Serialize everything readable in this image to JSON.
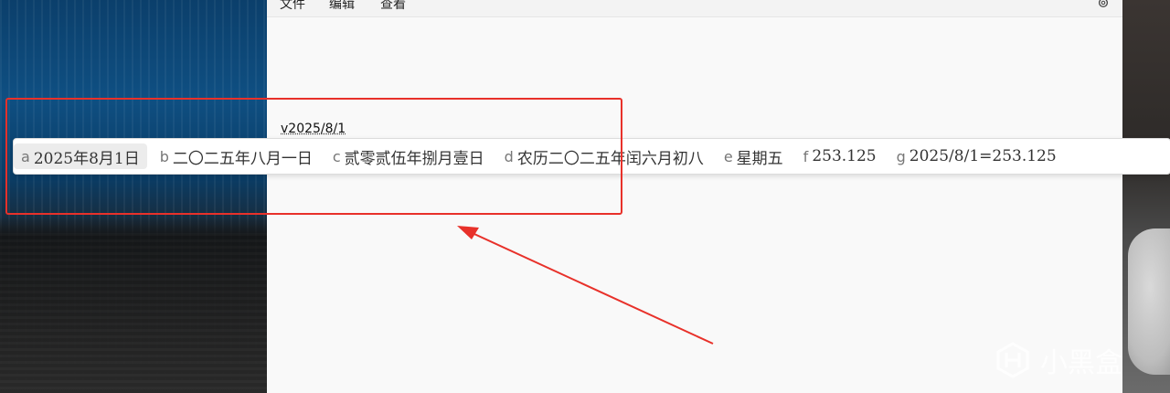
{
  "menu": {
    "file": "文件",
    "edit": "编辑",
    "view": "查看"
  },
  "editor": {
    "text": "v2025/8/1"
  },
  "candidates": [
    {
      "key": "a",
      "text": "2025年8月1日"
    },
    {
      "key": "b",
      "text": "二〇二五年八月一日"
    },
    {
      "key": "c",
      "text": "贰零贰伍年捌月壹日"
    },
    {
      "key": "d",
      "text": "农历二〇二五年闰六月初八"
    },
    {
      "key": "e",
      "text": "星期五"
    },
    {
      "key": "f",
      "text": "253.125"
    },
    {
      "key": "g",
      "text": "2025/8/1=253.125"
    }
  ],
  "watermark": {
    "text": "小黑盒"
  },
  "colors": {
    "annotation": "#e8312a",
    "accent": "#0067c0"
  }
}
